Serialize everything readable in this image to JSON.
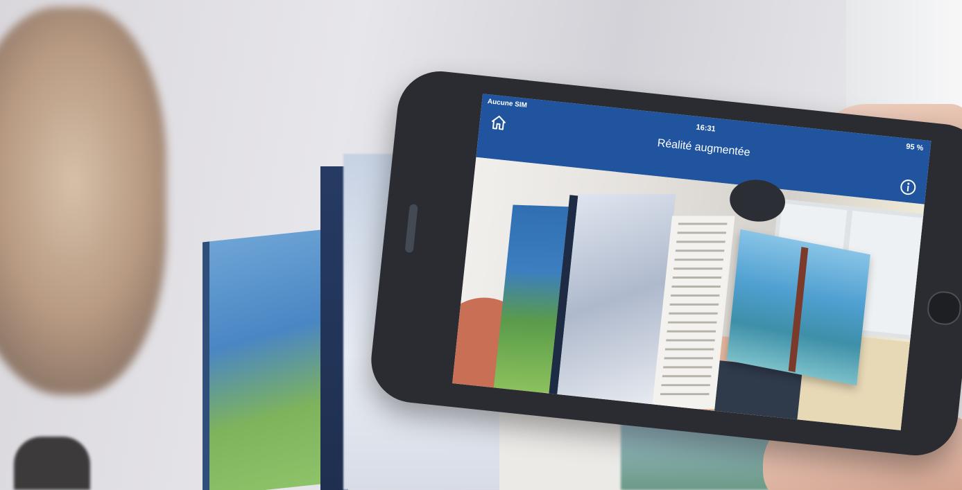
{
  "app": {
    "status_bar": {
      "carrier": "Aucune SIM",
      "time": "16:31",
      "battery": "95 %"
    },
    "nav_bar": {
      "title": "Réalité augmentée",
      "home_icon": "home-icon",
      "info_icon": "info-icon"
    }
  },
  "colors": {
    "nav_bar": "#20549f",
    "nav_text": "#ffffff",
    "phone_body": "#2a2c31"
  }
}
